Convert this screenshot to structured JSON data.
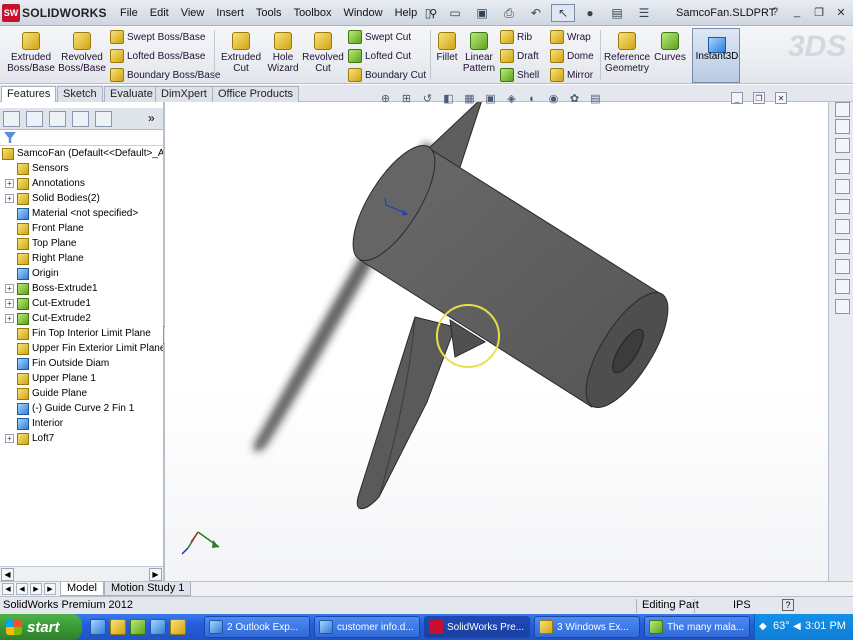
{
  "app": {
    "logo_prefix": "SW",
    "logo_text": "SOLIDWORKS",
    "document_title": "SamcoFan.SLDPRT",
    "help_glyph": "?"
  },
  "menu": [
    "File",
    "Edit",
    "View",
    "Insert",
    "Tools",
    "Toolbox",
    "Window",
    "Help"
  ],
  "ribbon": {
    "extruded_boss": "Extruded Boss/Base",
    "revolved_boss": "Revolved Boss/Base",
    "swept_boss": "Swept Boss/Base",
    "lofted_boss": "Lofted Boss/Base",
    "boundary_boss": "Boundary Boss/Base",
    "extruded_cut": "Extruded Cut",
    "hole_wizard": "Hole Wizard",
    "revolved_cut": "Revolved Cut",
    "swept_cut": "Swept Cut",
    "lofted_cut": "Lofted Cut",
    "boundary_cut": "Boundary Cut",
    "fillet": "Fillet",
    "linear_pattern": "Linear Pattern",
    "rib": "Rib",
    "draft": "Draft",
    "shell": "Shell",
    "wrap": "Wrap",
    "dome": "Dome",
    "mirror": "Mirror",
    "reference_geometry": "Reference Geometry",
    "curves": "Curves",
    "instant3d": "Instant3D",
    "ds_logo": "3DS"
  },
  "tabs": [
    "Features",
    "Sketch",
    "Evaluate",
    "DimXpert",
    "Office Products"
  ],
  "tree": {
    "root": "SamcoFan  (Default<<Default>_Ap",
    "items": [
      {
        "label": "Sensors",
        "expandable": false,
        "icon": "sensor-icon"
      },
      {
        "label": "Annotations",
        "expandable": true,
        "icon": "annotation-icon"
      },
      {
        "label": "Solid Bodies(2)",
        "expandable": true,
        "icon": "solid-bodies-icon"
      },
      {
        "label": "Material <not specified>",
        "expandable": false,
        "icon": "material-icon"
      },
      {
        "label": "Front Plane",
        "expandable": false,
        "icon": "plane-icon"
      },
      {
        "label": "Top Plane",
        "expandable": false,
        "icon": "plane-icon"
      },
      {
        "label": "Right Plane",
        "expandable": false,
        "icon": "plane-icon"
      },
      {
        "label": "Origin",
        "expandable": false,
        "icon": "origin-icon"
      },
      {
        "label": "Boss-Extrude1",
        "expandable": true,
        "icon": "extrude-icon"
      },
      {
        "label": "Cut-Extrude1",
        "expandable": true,
        "icon": "extrude-icon"
      },
      {
        "label": "Cut-Extrude2",
        "expandable": true,
        "icon": "extrude-icon"
      },
      {
        "label": "Fin Top Interior Limit Plane",
        "expandable": false,
        "icon": "plane-icon"
      },
      {
        "label": "Upper Fin Exterior Limit Plane",
        "expandable": false,
        "icon": "plane-icon"
      },
      {
        "label": "Fin Outside Diam",
        "expandable": false,
        "icon": "sketch-icon"
      },
      {
        "label": "Upper Plane 1",
        "expandable": false,
        "icon": "plane-icon"
      },
      {
        "label": "Guide Plane",
        "expandable": false,
        "icon": "plane-icon"
      },
      {
        "label": "(-) Guide Curve 2 Fin 1",
        "expandable": false,
        "icon": "sketch-icon"
      },
      {
        "label": "Interior",
        "expandable": false,
        "icon": "sketch-icon"
      },
      {
        "label": "Loft7",
        "expandable": true,
        "icon": "loft-icon"
      }
    ]
  },
  "bottom_tabs": [
    "Model",
    "Motion Study 1"
  ],
  "status": {
    "product": "SolidWorks Premium 2012",
    "mode": "Editing Part",
    "units": "IPS",
    "help": "?"
  },
  "taskbar": {
    "start_label": "start",
    "tasks": [
      {
        "label": "2 Outlook Exp...",
        "active": false
      },
      {
        "label": "customer info.d...",
        "active": false
      },
      {
        "label": "SolidWorks Pre...",
        "active": true
      },
      {
        "label": "3 Windows Ex...",
        "active": false
      },
      {
        "label": "The many mala...",
        "active": false
      }
    ],
    "temperature": "63°",
    "clock": "3:01 PM"
  },
  "colors": {
    "model_fill": "#5c5c5c",
    "selection_circle": "#e8e04a",
    "taskbar_blue": "#245edb",
    "start_green": "#3a9a36"
  }
}
